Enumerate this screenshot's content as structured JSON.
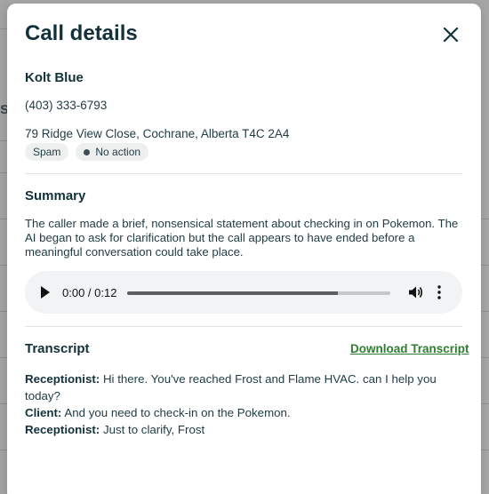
{
  "modal": {
    "title": "Call details",
    "contact": {
      "name": "Kolt Blue",
      "phone": "(403) 333-6793",
      "address": "79 Ridge View Close, Cochrane, Alberta T4C 2A4"
    },
    "tags": [
      {
        "label": "Spam"
      },
      {
        "label": "No action"
      }
    ],
    "summary": {
      "title": "Summary",
      "text": "The caller made a brief, nonsensical statement about checking in on Pokemon. The AI began to ask for clarification but the call appears to have ended before a meaningful conversation could take place."
    },
    "audio": {
      "time": "0:00 / 0:12",
      "progress": 0.8,
      "icons": [
        "play-icon",
        "volume-icon",
        "more-vertical-icon"
      ]
    },
    "transcript": {
      "title": "Transcript",
      "download_label": "Download Transcript",
      "lines": [
        {
          "speaker": "Receptionist:",
          "text": "Hi there. You've reached Frost and Flame HVAC. can I help you today?"
        },
        {
          "speaker": "Client:",
          "text": "And you need to check-in on the Pokemon."
        },
        {
          "speaker": "Receptionist:",
          "text": "Just to clarify, Frost"
        }
      ]
    },
    "close_icon": "close-icon"
  },
  "colors": {
    "heading": "#12313a",
    "link": "#2f7d32",
    "overlay": "#a6a6a6"
  }
}
